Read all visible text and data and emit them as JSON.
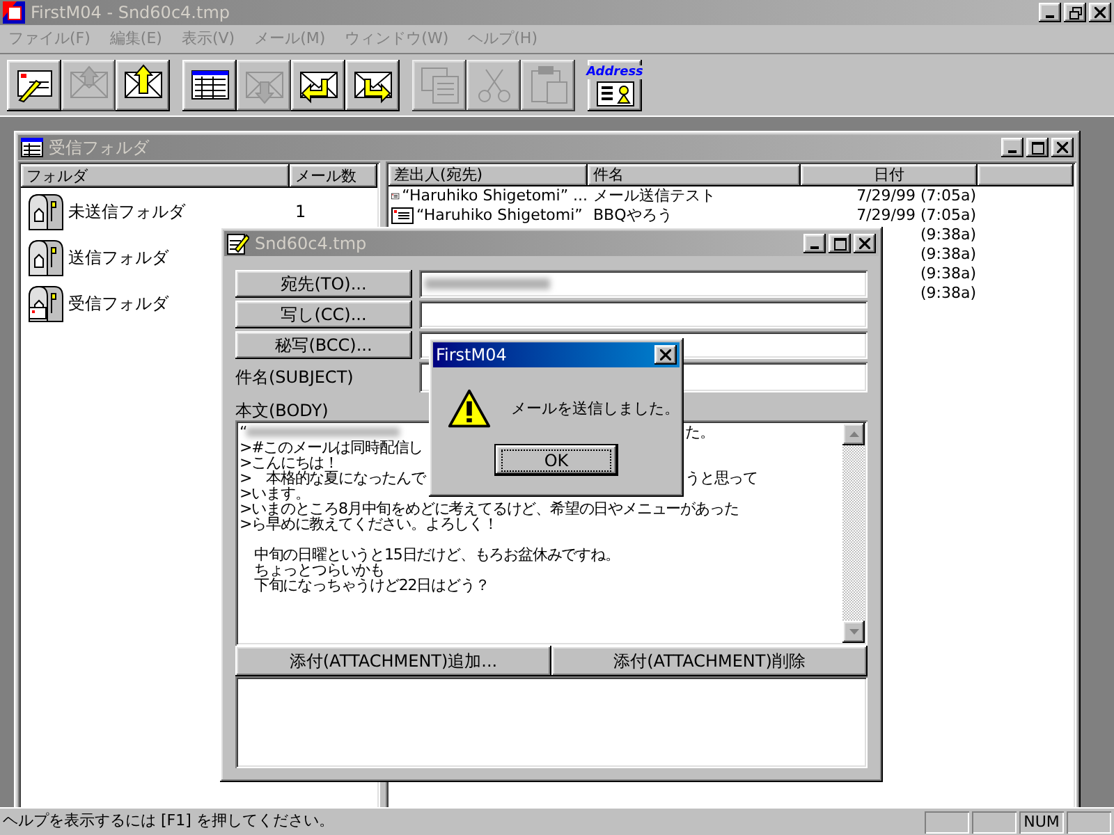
{
  "window": {
    "title": "FirstM04 - Snd60c4.tmp"
  },
  "menu": [
    {
      "label": "ファイル(F)",
      "disabled": true
    },
    {
      "label": "編集(E)",
      "disabled": true
    },
    {
      "label": "表示(V)",
      "disabled": true
    },
    {
      "label": "メール(M)",
      "disabled": true
    },
    {
      "label": "ウィンドウ(W)",
      "disabled": true
    },
    {
      "label": "ヘルプ(H)",
      "disabled": true
    }
  ],
  "toolbar": [
    [
      {
        "kind": "compose",
        "disabled": false
      },
      {
        "kind": "send",
        "disabled": true
      },
      {
        "kind": "upload",
        "disabled": false
      }
    ],
    [
      {
        "kind": "list",
        "disabled": false
      },
      {
        "kind": "receive",
        "disabled": true
      },
      {
        "kind": "reply",
        "disabled": false
      },
      {
        "kind": "forward",
        "disabled": false
      }
    ],
    [
      {
        "kind": "copy",
        "disabled": true
      },
      {
        "kind": "cut",
        "disabled": true
      },
      {
        "kind": "paste",
        "disabled": true
      }
    ],
    [
      {
        "kind": "address",
        "disabled": false,
        "label": "Address"
      }
    ]
  ],
  "folder_window": {
    "title": "受信フォルダ",
    "folder_columns": [
      "フォルダ",
      "メール数"
    ],
    "folders": [
      {
        "kind": "unsent",
        "name": "未送信フォルダ",
        "count": "1"
      },
      {
        "kind": "sent",
        "name": "送信フォルダ"
      },
      {
        "kind": "inbox",
        "name": "受信フォルダ"
      }
    ],
    "mail_columns": [
      "差出人(宛先)",
      "件名",
      "日付"
    ],
    "mails": [
      {
        "sender": "“Haruhiko Shigetomi” ...",
        "subject": "メール送信テスト",
        "date": "7/29/99 (7:05a)"
      },
      {
        "sender": "“Haruhiko Shigetomi”",
        "subject": "BBQやろう",
        "date": "7/29/99 (7:05a)"
      },
      {
        "date": "(9:38a)"
      },
      {
        "date": "(9:38a)"
      },
      {
        "date": "(9:38a)"
      },
      {
        "date": "(9:38a)"
      }
    ]
  },
  "compose": {
    "title": "Snd60c4.tmp",
    "address_fields": [
      {
        "label": "宛先(TO)...",
        "redacted": true
      },
      {
        "label": "写し(CC)...",
        "redacted": false
      },
      {
        "label": "秘写(BCC)...",
        "redacted": false
      }
    ],
    "subject_label": "件名(SUBJECT)",
    "body_label": "本文(BODY)",
    "body_lines": [
      {
        "text": "“",
        "redacted": true,
        "text_right": "た。"
      },
      {
        "text": ">#このメールは同時配信し"
      },
      {
        "text": ">こんにちは！"
      },
      {
        "text": ">　本格的な夏になったんで",
        "text_right": "うと思って"
      },
      {
        "text": ">います。"
      },
      {
        "text": ">いまのところ8月中旬をめどに考えてるけど、希望の日やメニューがあった"
      },
      {
        "text": ">ら早めに教えてください。よろしく！"
      },
      {
        "blank_line_before": true,
        "text": "　中旬の日曜というと15日だけど、もろお盆休みですね。"
      },
      {
        "text": "　ちょっとつらいかも"
      },
      {
        "text": "　下旬になっちゃうけど22日はどう？"
      }
    ],
    "attachment_buttons": [
      "添付(ATTACHMENT)追加...",
      "添付(ATTACHMENT)削除"
    ]
  },
  "dialog": {
    "title": "FirstM04",
    "message": "メールを送信しました。",
    "button": "OK"
  },
  "status_bar": {
    "text": "ヘルプを表示するには [F1] を押してください。",
    "panels": [
      {
        "kind": "blank"
      },
      {
        "kind": "blank"
      },
      {
        "kind": "text",
        "label": "NUM"
      },
      {
        "kind": "blank"
      }
    ]
  }
}
